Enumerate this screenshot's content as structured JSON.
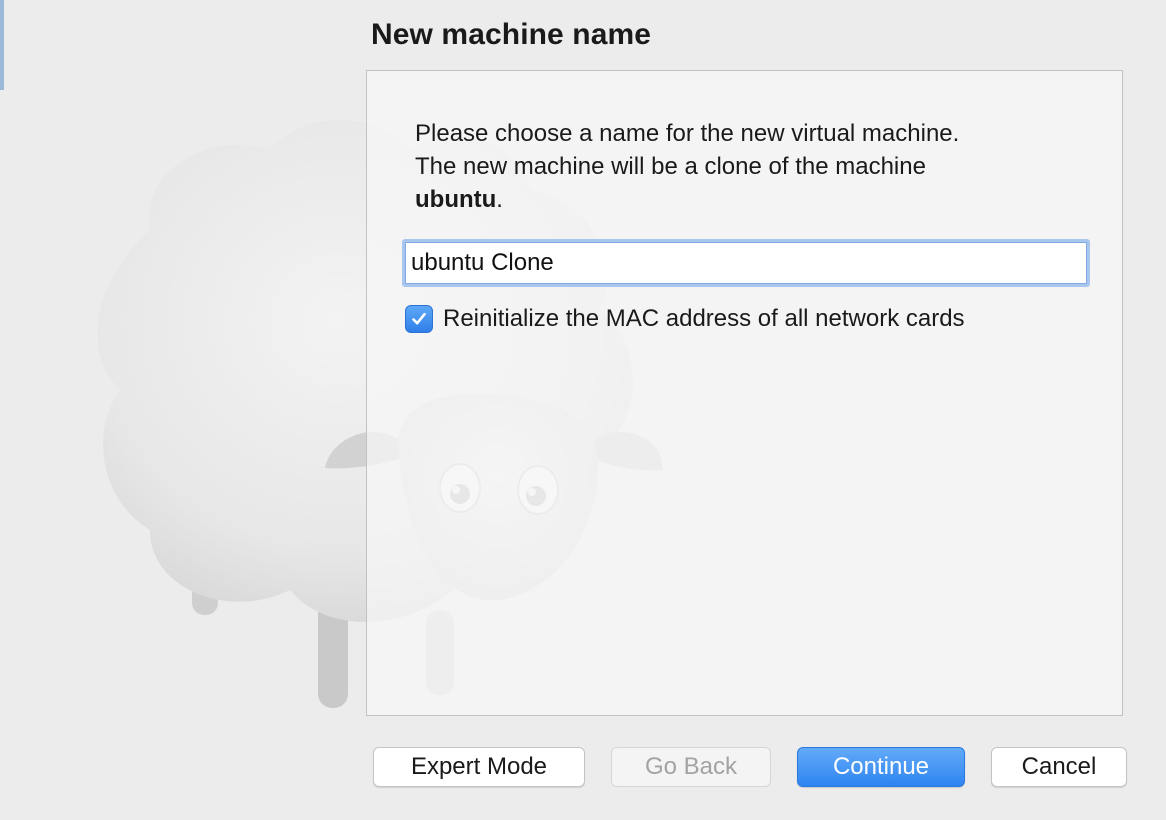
{
  "page": {
    "title": "New machine name"
  },
  "panel": {
    "description_line1": "Please choose a name for the new virtual machine.",
    "description_line2": "The new machine will be a clone of the machine",
    "source_machine": "ubuntu",
    "description_end": ".",
    "name_input_value": "ubuntu Clone",
    "mac_checkbox_label": "Reinitialize the MAC address of all network cards",
    "mac_checkbox_checked": true
  },
  "buttons": {
    "expert_mode": "Expert Mode",
    "go_back": "Go Back",
    "continue": "Continue",
    "cancel": "Cancel"
  },
  "colors": {
    "accent": "#2e84f0",
    "focus_ring": "#a9c6ee"
  },
  "icons": {
    "checkbox": "checkmark-icon",
    "background": "sheep-mascot-icon"
  }
}
